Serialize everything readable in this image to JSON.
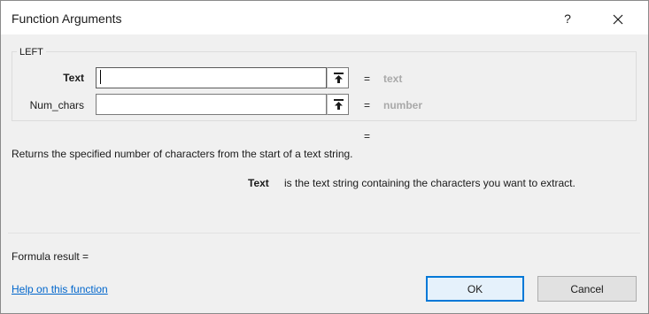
{
  "dialog": {
    "title": "Function Arguments",
    "help_glyph": "?",
    "close_icon": "close-icon"
  },
  "function": {
    "name": "LEFT",
    "arguments": [
      {
        "label": "Text",
        "value": "",
        "equals": "=",
        "hint": "text",
        "bold": true
      },
      {
        "label": "Num_chars",
        "value": "",
        "equals": "=",
        "hint": "number",
        "bold": false
      }
    ],
    "result_equals": "=",
    "description": "Returns the specified number of characters from the start of a text string.",
    "current_arg_name": "Text",
    "current_arg_help": "is the text string containing the characters you want to extract."
  },
  "footer": {
    "formula_result_label": "Formula result =",
    "help_link": "Help on this function",
    "ok_label": "OK",
    "cancel_label": "Cancel"
  },
  "colors": {
    "accent": "#0078d7",
    "link": "#0066cc",
    "hint": "#a9a9a9",
    "background": "#f0f0f0"
  }
}
